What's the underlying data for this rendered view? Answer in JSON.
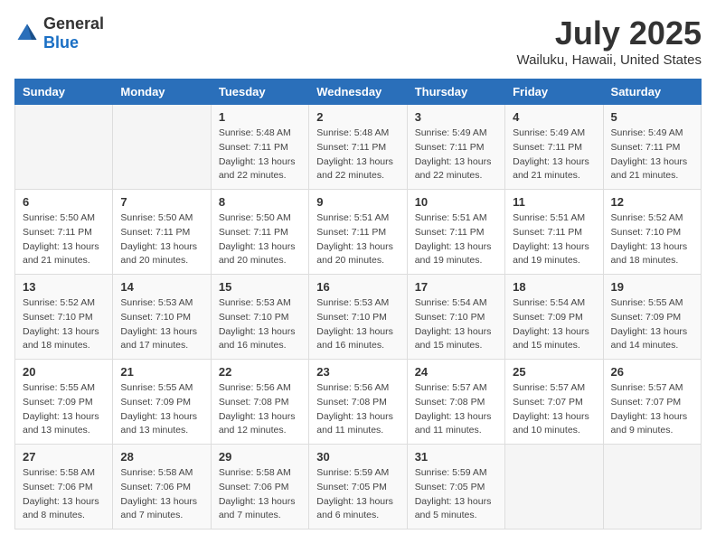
{
  "logo": {
    "general": "General",
    "blue": "Blue"
  },
  "title": "July 2025",
  "location": "Wailuku, Hawaii, United States",
  "days_of_week": [
    "Sunday",
    "Monday",
    "Tuesday",
    "Wednesday",
    "Thursday",
    "Friday",
    "Saturday"
  ],
  "weeks": [
    [
      {
        "day": "",
        "sunrise": "",
        "sunset": "",
        "daylight": ""
      },
      {
        "day": "",
        "sunrise": "",
        "sunset": "",
        "daylight": ""
      },
      {
        "day": "1",
        "sunrise": "Sunrise: 5:48 AM",
        "sunset": "Sunset: 7:11 PM",
        "daylight": "Daylight: 13 hours and 22 minutes."
      },
      {
        "day": "2",
        "sunrise": "Sunrise: 5:48 AM",
        "sunset": "Sunset: 7:11 PM",
        "daylight": "Daylight: 13 hours and 22 minutes."
      },
      {
        "day": "3",
        "sunrise": "Sunrise: 5:49 AM",
        "sunset": "Sunset: 7:11 PM",
        "daylight": "Daylight: 13 hours and 22 minutes."
      },
      {
        "day": "4",
        "sunrise": "Sunrise: 5:49 AM",
        "sunset": "Sunset: 7:11 PM",
        "daylight": "Daylight: 13 hours and 21 minutes."
      },
      {
        "day": "5",
        "sunrise": "Sunrise: 5:49 AM",
        "sunset": "Sunset: 7:11 PM",
        "daylight": "Daylight: 13 hours and 21 minutes."
      }
    ],
    [
      {
        "day": "6",
        "sunrise": "Sunrise: 5:50 AM",
        "sunset": "Sunset: 7:11 PM",
        "daylight": "Daylight: 13 hours and 21 minutes."
      },
      {
        "day": "7",
        "sunrise": "Sunrise: 5:50 AM",
        "sunset": "Sunset: 7:11 PM",
        "daylight": "Daylight: 13 hours and 20 minutes."
      },
      {
        "day": "8",
        "sunrise": "Sunrise: 5:50 AM",
        "sunset": "Sunset: 7:11 PM",
        "daylight": "Daylight: 13 hours and 20 minutes."
      },
      {
        "day": "9",
        "sunrise": "Sunrise: 5:51 AM",
        "sunset": "Sunset: 7:11 PM",
        "daylight": "Daylight: 13 hours and 20 minutes."
      },
      {
        "day": "10",
        "sunrise": "Sunrise: 5:51 AM",
        "sunset": "Sunset: 7:11 PM",
        "daylight": "Daylight: 13 hours and 19 minutes."
      },
      {
        "day": "11",
        "sunrise": "Sunrise: 5:51 AM",
        "sunset": "Sunset: 7:11 PM",
        "daylight": "Daylight: 13 hours and 19 minutes."
      },
      {
        "day": "12",
        "sunrise": "Sunrise: 5:52 AM",
        "sunset": "Sunset: 7:10 PM",
        "daylight": "Daylight: 13 hours and 18 minutes."
      }
    ],
    [
      {
        "day": "13",
        "sunrise": "Sunrise: 5:52 AM",
        "sunset": "Sunset: 7:10 PM",
        "daylight": "Daylight: 13 hours and 18 minutes."
      },
      {
        "day": "14",
        "sunrise": "Sunrise: 5:53 AM",
        "sunset": "Sunset: 7:10 PM",
        "daylight": "Daylight: 13 hours and 17 minutes."
      },
      {
        "day": "15",
        "sunrise": "Sunrise: 5:53 AM",
        "sunset": "Sunset: 7:10 PM",
        "daylight": "Daylight: 13 hours and 16 minutes."
      },
      {
        "day": "16",
        "sunrise": "Sunrise: 5:53 AM",
        "sunset": "Sunset: 7:10 PM",
        "daylight": "Daylight: 13 hours and 16 minutes."
      },
      {
        "day": "17",
        "sunrise": "Sunrise: 5:54 AM",
        "sunset": "Sunset: 7:10 PM",
        "daylight": "Daylight: 13 hours and 15 minutes."
      },
      {
        "day": "18",
        "sunrise": "Sunrise: 5:54 AM",
        "sunset": "Sunset: 7:09 PM",
        "daylight": "Daylight: 13 hours and 15 minutes."
      },
      {
        "day": "19",
        "sunrise": "Sunrise: 5:55 AM",
        "sunset": "Sunset: 7:09 PM",
        "daylight": "Daylight: 13 hours and 14 minutes."
      }
    ],
    [
      {
        "day": "20",
        "sunrise": "Sunrise: 5:55 AM",
        "sunset": "Sunset: 7:09 PM",
        "daylight": "Daylight: 13 hours and 13 minutes."
      },
      {
        "day": "21",
        "sunrise": "Sunrise: 5:55 AM",
        "sunset": "Sunset: 7:09 PM",
        "daylight": "Daylight: 13 hours and 13 minutes."
      },
      {
        "day": "22",
        "sunrise": "Sunrise: 5:56 AM",
        "sunset": "Sunset: 7:08 PM",
        "daylight": "Daylight: 13 hours and 12 minutes."
      },
      {
        "day": "23",
        "sunrise": "Sunrise: 5:56 AM",
        "sunset": "Sunset: 7:08 PM",
        "daylight": "Daylight: 13 hours and 11 minutes."
      },
      {
        "day": "24",
        "sunrise": "Sunrise: 5:57 AM",
        "sunset": "Sunset: 7:08 PM",
        "daylight": "Daylight: 13 hours and 11 minutes."
      },
      {
        "day": "25",
        "sunrise": "Sunrise: 5:57 AM",
        "sunset": "Sunset: 7:07 PM",
        "daylight": "Daylight: 13 hours and 10 minutes."
      },
      {
        "day": "26",
        "sunrise": "Sunrise: 5:57 AM",
        "sunset": "Sunset: 7:07 PM",
        "daylight": "Daylight: 13 hours and 9 minutes."
      }
    ],
    [
      {
        "day": "27",
        "sunrise": "Sunrise: 5:58 AM",
        "sunset": "Sunset: 7:06 PM",
        "daylight": "Daylight: 13 hours and 8 minutes."
      },
      {
        "day": "28",
        "sunrise": "Sunrise: 5:58 AM",
        "sunset": "Sunset: 7:06 PM",
        "daylight": "Daylight: 13 hours and 7 minutes."
      },
      {
        "day": "29",
        "sunrise": "Sunrise: 5:58 AM",
        "sunset": "Sunset: 7:06 PM",
        "daylight": "Daylight: 13 hours and 7 minutes."
      },
      {
        "day": "30",
        "sunrise": "Sunrise: 5:59 AM",
        "sunset": "Sunset: 7:05 PM",
        "daylight": "Daylight: 13 hours and 6 minutes."
      },
      {
        "day": "31",
        "sunrise": "Sunrise: 5:59 AM",
        "sunset": "Sunset: 7:05 PM",
        "daylight": "Daylight: 13 hours and 5 minutes."
      },
      {
        "day": "",
        "sunrise": "",
        "sunset": "",
        "daylight": ""
      },
      {
        "day": "",
        "sunrise": "",
        "sunset": "",
        "daylight": ""
      }
    ]
  ]
}
